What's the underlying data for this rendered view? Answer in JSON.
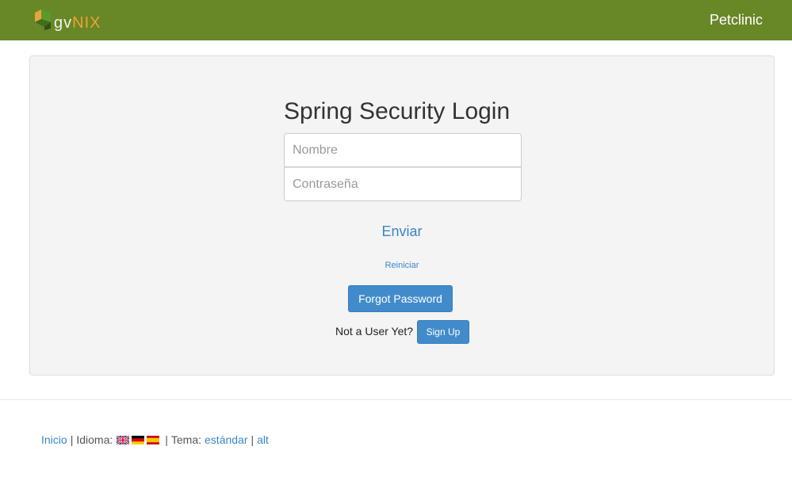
{
  "header": {
    "logo_gv": "gv",
    "logo_nix": "NIX",
    "app_title": "Petclinic",
    "colors": {
      "bar": "#688727",
      "logo_accent": "#f2a12e"
    }
  },
  "login": {
    "title": "Spring Security Login",
    "username_placeholder": "Nombre",
    "password_placeholder": "Contraseña",
    "submit_label": "Enviar",
    "reset_label": "Reiniciar",
    "forgot_label": "Forgot Password",
    "not_user_text": "Not a User Yet?",
    "signup_label": "Sign Up"
  },
  "footer": {
    "home_label": "Inicio",
    "language_label": "Idioma:",
    "flags": [
      "flag-uk-icon",
      "flag-de-icon",
      "flag-es-icon"
    ],
    "theme_label": "Tema:",
    "theme_standard": "estándar",
    "theme_alt": "alt",
    "separator": "|"
  },
  "colors": {
    "link": "#3a87c8",
    "primary_button": "#428bca",
    "panel": "#f4f4f4"
  }
}
